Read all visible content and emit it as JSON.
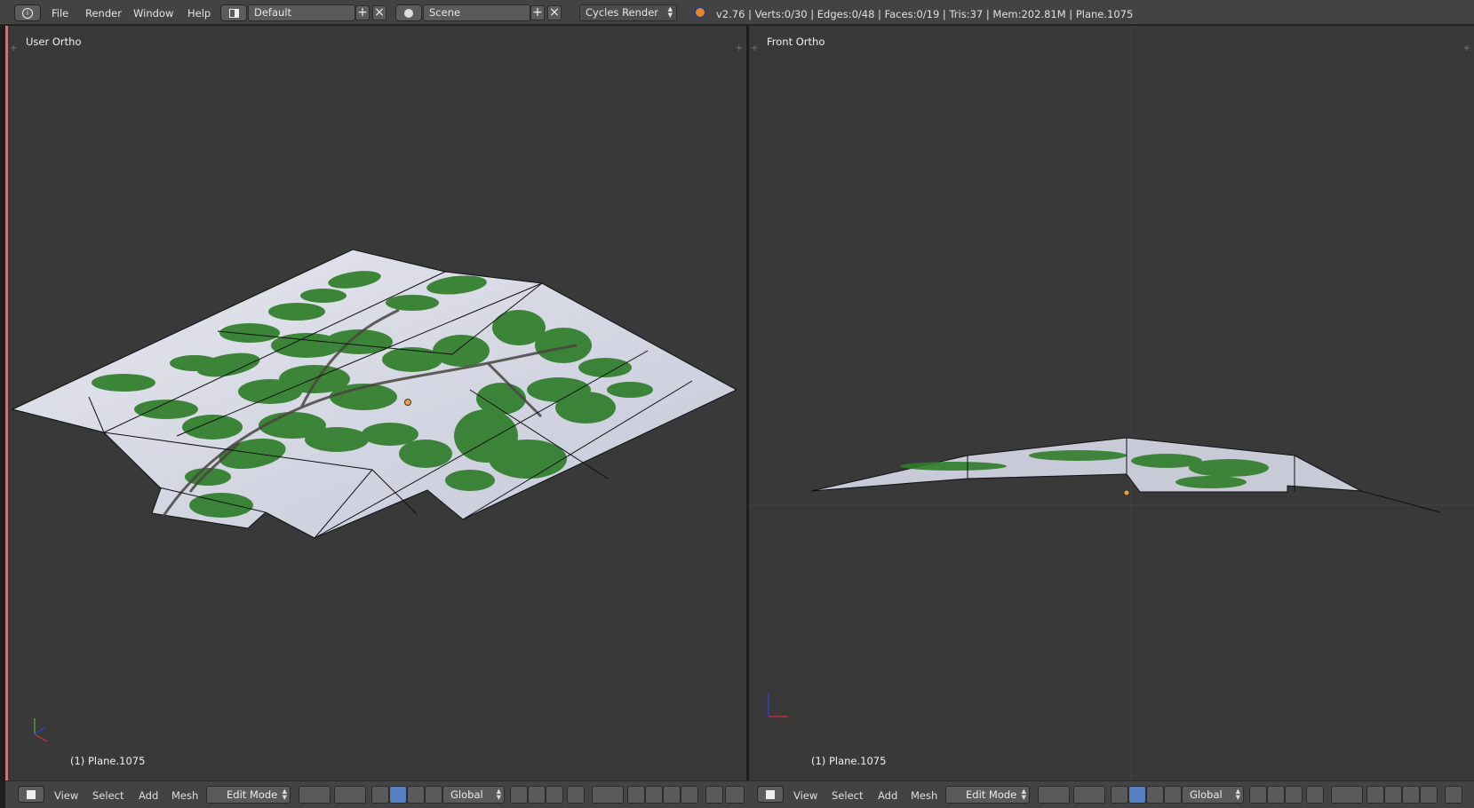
{
  "topbar": {
    "menus": [
      "File",
      "Render",
      "Window",
      "Help"
    ],
    "layout_name": "Default",
    "scene_name": "Scene",
    "render_engine": "Cycles Render",
    "stats": "v2.76 | Verts:0/30 | Edges:0/48 | Faces:0/19 | Tris:37 | Mem:202.81M | Plane.1075"
  },
  "viewports": [
    {
      "title": "User Ortho",
      "object_label": "(1) Plane.1075"
    },
    {
      "title": "Front Ortho",
      "object_label": "(1) Plane.1075"
    }
  ],
  "bottombar": {
    "menus": [
      "View",
      "Select",
      "Add",
      "Mesh"
    ],
    "mode": "Edit Mode",
    "orientation": "Global"
  },
  "colors": {
    "viewport_bg": "#393939",
    "header_bg": "#434343",
    "leaf_green": "#2f7d2a",
    "mesh_surface": "#d8dae6",
    "active_blue": "#5680c2"
  }
}
